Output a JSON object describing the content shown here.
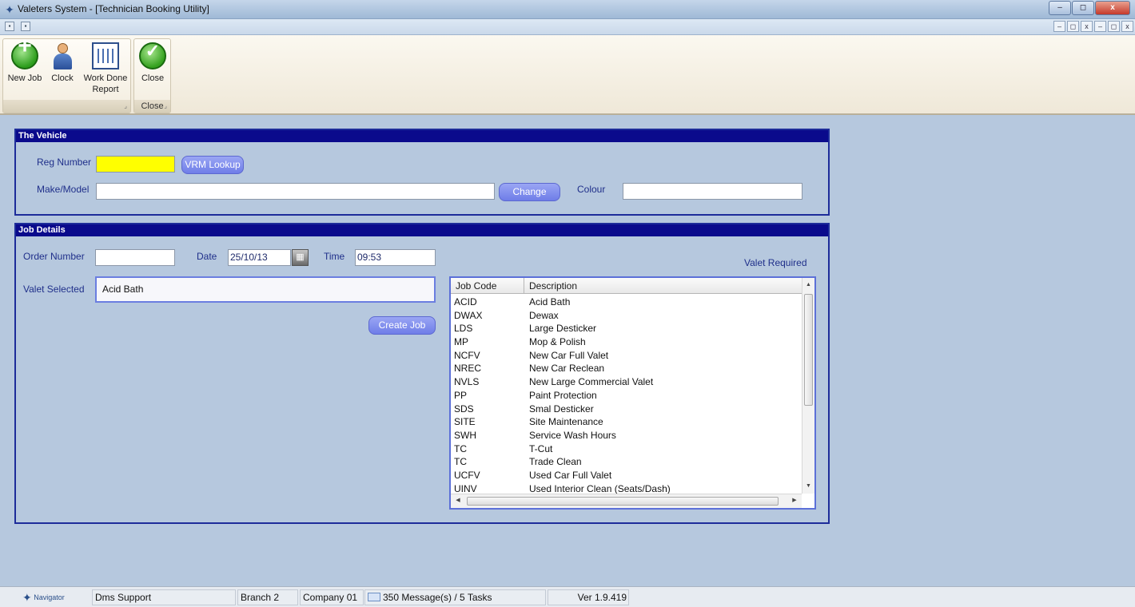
{
  "window": {
    "title": "Valeters System - [Technician Booking Utility]",
    "controls": {
      "minimize": "–",
      "restore": "◻",
      "close": "x"
    }
  },
  "mdi": {
    "controls": [
      "–",
      "◻",
      "x",
      "–",
      "◻",
      "x"
    ]
  },
  "ribbon": {
    "buttons": {
      "new_job": "New Job",
      "clock": "Clock",
      "work_done_line1": "Work Done",
      "work_done_line2": "Report",
      "close": "Close"
    },
    "groups": {
      "main": "",
      "close": "Close"
    }
  },
  "vehicle": {
    "header": "The Vehicle",
    "reg_label": "Reg Number",
    "reg_value": "",
    "vrm_button": "VRM Lookup",
    "make_label": "Make/Model",
    "make_value": "",
    "change_button": "Change",
    "colour_label": "Colour",
    "colour_value": ""
  },
  "job": {
    "header": "Job Details",
    "order_label": "Order Number",
    "order_value": "",
    "date_label": "Date",
    "date_value": "25/10/13",
    "time_label": "Time",
    "time_value": "09:53",
    "valet_selected_label": "Valet Selected",
    "valet_selected_value": "Acid Bath",
    "create_button": "Create Job",
    "valet_required_label": "Valet Required",
    "list_headers": {
      "code": "Job Code",
      "description": "Description"
    },
    "list_items": [
      {
        "code": "ACID",
        "description": "Acid Bath"
      },
      {
        "code": "DWAX",
        "description": "Dewax"
      },
      {
        "code": "LDS",
        "description": "Large Desticker"
      },
      {
        "code": "MP",
        "description": "Mop & Polish"
      },
      {
        "code": "NCFV",
        "description": "New Car Full Valet"
      },
      {
        "code": "NREC",
        "description": "New Car Reclean"
      },
      {
        "code": "NVLS",
        "description": "New Large Commercial Valet"
      },
      {
        "code": "PP",
        "description": "Paint Protection"
      },
      {
        "code": "SDS",
        "description": "Smal Desticker"
      },
      {
        "code": "SITE",
        "description": "Site Maintenance"
      },
      {
        "code": "SWH",
        "description": "Service Wash Hours"
      },
      {
        "code": "TC",
        "description": "T-Cut"
      },
      {
        "code": "TC",
        "description": "Trade Clean"
      },
      {
        "code": "UCFV",
        "description": "Used Car Full Valet"
      },
      {
        "code": "UINV",
        "description": "Used Interior Clean (Seats/Dash)"
      }
    ]
  },
  "status": {
    "navigator": "Navigator",
    "user": "Dms Support",
    "branch": "Branch 2",
    "company": "Company 01",
    "messages": "350 Message(s) / 5 Tasks",
    "version": "Ver 1.9.419"
  },
  "icons": {
    "app": "navigator-star-icon",
    "new_job": "add-circle-icon",
    "clock": "person-icon",
    "report": "report-icon",
    "close": "check-circle-icon",
    "calendar": "calendar-icon",
    "mail": "envelope-icon"
  }
}
